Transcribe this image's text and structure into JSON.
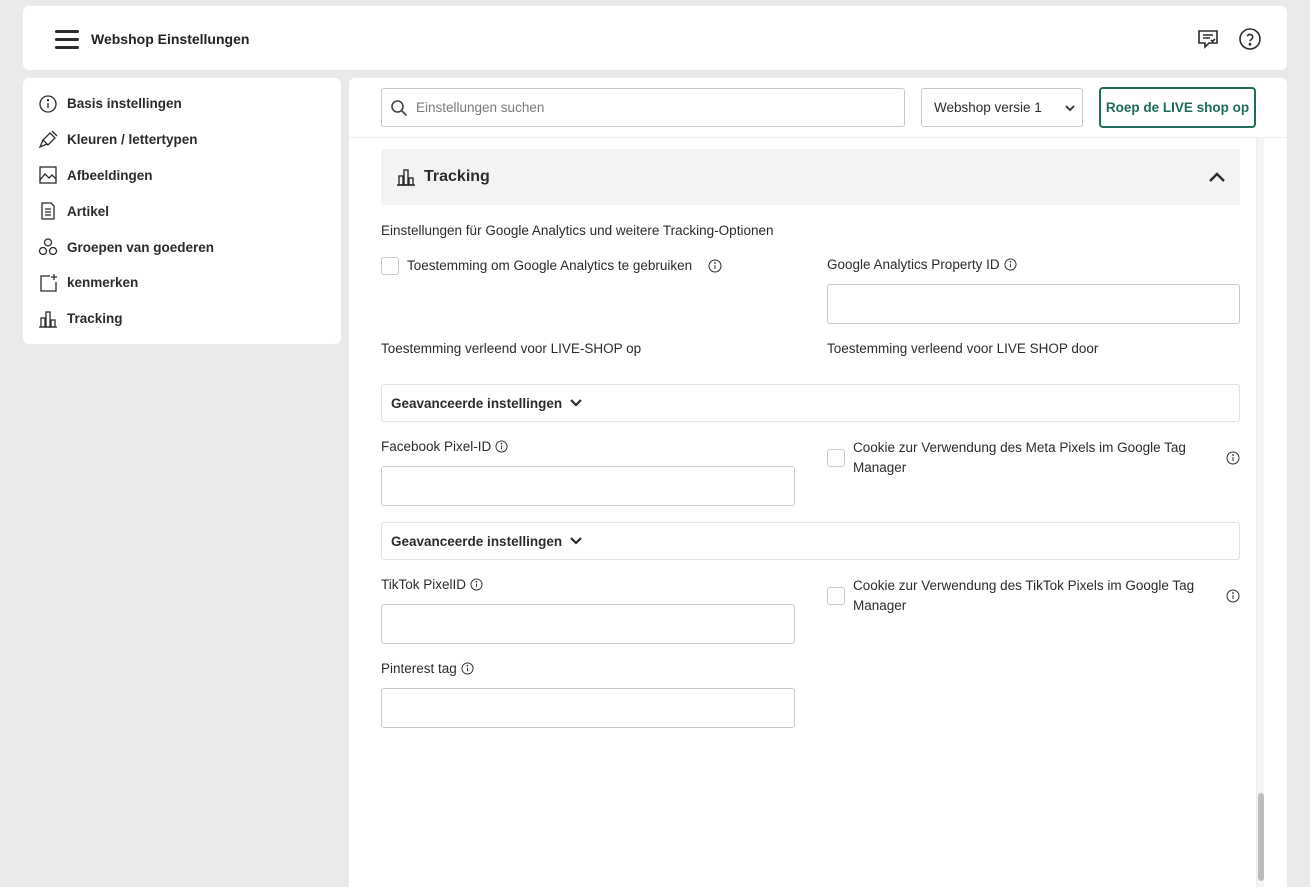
{
  "header": {
    "title": "Webshop Einstellungen",
    "icons": [
      "menu-icon",
      "feedback-icon",
      "help-icon"
    ]
  },
  "sidebar": {
    "items": [
      {
        "label": "Basis instellingen",
        "icon": "info-icon"
      },
      {
        "label": "Kleuren / lettertypen",
        "icon": "paint-icon"
      },
      {
        "label": "Afbeeldingen",
        "icon": "image-icon"
      },
      {
        "label": "Artikel",
        "icon": "document-icon"
      },
      {
        "label": "Groepen van goederen",
        "icon": "groups-icon"
      },
      {
        "label": "kenmerken",
        "icon": "attribute-add-icon"
      },
      {
        "label": "Tracking",
        "icon": "bar-chart-icon"
      }
    ]
  },
  "toolbar": {
    "search_placeholder": "Einstellungen suchen",
    "search_value": "",
    "version_selected": "Webshop versie 1",
    "live_button": "Roep de LIVE shop op"
  },
  "section": {
    "title": "Tracking",
    "description": "Einstellungen für Google Analytics und weitere Tracking-Optionen",
    "ga_consent_label": "Toestemming om Google Analytics te gebruiken",
    "ga_property_label": "Google Analytics Property ID",
    "ga_property_value": "",
    "consent_on": "Toestemming verleend voor LIVE-SHOP op",
    "consent_by": "Toestemming verleend voor LIVE SHOP door",
    "advanced_label": "Geavanceerde instellingen",
    "facebook_label": "Facebook Pixel-ID",
    "facebook_value": "",
    "meta_cookie_label": "Cookie zur Verwendung des Meta Pixels im Google Tag Manager",
    "advanced_label_2": "Geavanceerde instellingen",
    "tiktok_label": "TikTok PixelID",
    "tiktok_value": "",
    "tiktok_cookie_label": "Cookie zur Verwendung des TikTok Pixels im Google Tag Manager",
    "pinterest_label": "Pinterest tag",
    "pinterest_value": ""
  },
  "colors": {
    "accent": "#1d6b5a",
    "background": "#ebe9e8",
    "panel": "#ffffff"
  }
}
